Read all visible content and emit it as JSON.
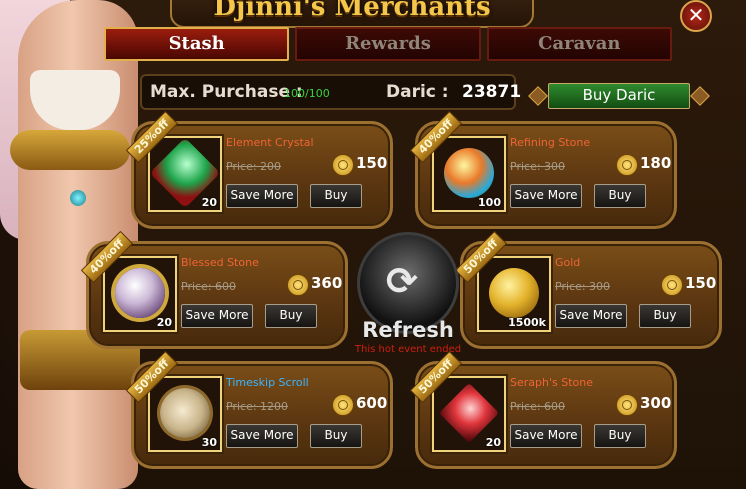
{
  "title": "Djinni's Merchants",
  "close_glyph": "✕",
  "tabs": [
    {
      "label": "Stash",
      "active": true
    },
    {
      "label": "Rewards",
      "active": false
    },
    {
      "label": "Caravan",
      "active": false
    }
  ],
  "info": {
    "max_purchase_label": "Max. Purchase :",
    "max_purchase_value": "100/100",
    "daric_label": "Daric :",
    "daric_value": "23871",
    "buy_daric_label": "Buy Daric"
  },
  "save_label": "Save More",
  "buy_label": "Buy",
  "items": [
    {
      "discount": "25%off",
      "name": "Element Crystal",
      "price": "Price: 200",
      "cost": "150",
      "qty": "20",
      "color": "#1ea34a"
    },
    {
      "discount": "40%off",
      "name": "Refining Stone",
      "price": "Price: 300",
      "cost": "180",
      "qty": "100",
      "color": "#e87a2a"
    },
    {
      "discount": "40%off",
      "name": "Blessed Stone",
      "price": "Price: 600",
      "cost": "360",
      "qty": "20",
      "color": "#cbb8d6"
    },
    {
      "discount": "50%off",
      "name": "Gold",
      "price": "Price: 300",
      "cost": "150",
      "qty": "1500k",
      "color": "#e3b22a"
    },
    {
      "discount": "50%off",
      "name": "Timeskip Scroll",
      "price": "Price: 1200",
      "cost": "600",
      "qty": "30",
      "color": "#c9b48a"
    },
    {
      "discount": "50%off",
      "name": "Seraph's Stone",
      "price": "Price: 600",
      "cost": "300",
      "qty": "20",
      "color": "#e0363c"
    }
  ],
  "refresh": {
    "label": "Refresh",
    "note": "This hot event ended",
    "glyph": "⟳"
  }
}
